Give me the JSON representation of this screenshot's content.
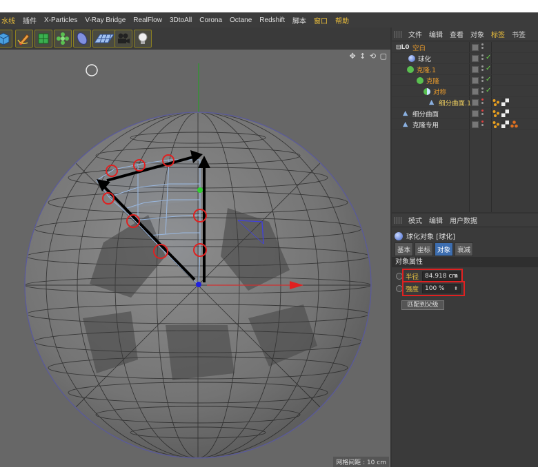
{
  "menubar": {
    "items": [
      {
        "label": "水线",
        "highlight": true
      },
      {
        "label": "插件",
        "highlight": false
      },
      {
        "label": "X-Particles",
        "highlight": false
      },
      {
        "label": "V-Ray Bridge",
        "highlight": false
      },
      {
        "label": "RealFlow",
        "highlight": false
      },
      {
        "label": "3DtoAll",
        "highlight": false
      },
      {
        "label": "Corona",
        "highlight": false
      },
      {
        "label": "Octane",
        "highlight": false
      },
      {
        "label": "Redshift",
        "highlight": false
      },
      {
        "label": "脚本",
        "highlight": false
      },
      {
        "label": "窗口",
        "highlight": false
      },
      {
        "label": "帮助",
        "highlight": true
      }
    ]
  },
  "toolbar": {
    "tools": [
      "cube-icon",
      "pen-icon",
      "subdivision-icon",
      "cloner-icon",
      "deformer-icon",
      "floor-icon",
      "camera-icon",
      "light-icon"
    ]
  },
  "viewport": {
    "grid_spacing_label": "网格间距 : 10 cm",
    "nav_icons": "✥ ↕ ⟲ ▢"
  },
  "object_manager": {
    "tabs": [
      {
        "label": "文件",
        "active": false
      },
      {
        "label": "编辑",
        "active": false
      },
      {
        "label": "查看",
        "active": false
      },
      {
        "label": "对象",
        "active": false
      },
      {
        "label": "标签",
        "active": true
      },
      {
        "label": "书签",
        "active": false
      }
    ],
    "rows": [
      {
        "name": "空白",
        "color": "orange",
        "indent": 0,
        "icon": "null-icon",
        "check": false,
        "tags": []
      },
      {
        "name": "球化",
        "color": "white",
        "indent": 1,
        "icon": "spherify-icon",
        "check": true,
        "tags": []
      },
      {
        "name": "克隆.1",
        "color": "orange",
        "indent": 1,
        "icon": "cloner-icon",
        "check": true,
        "tags": []
      },
      {
        "name": "克隆",
        "color": "orange",
        "indent": 2,
        "icon": "cloner-icon",
        "check": true,
        "tags": []
      },
      {
        "name": "对称",
        "color": "orange",
        "indent": 3,
        "icon": "symmetry-icon",
        "check": true,
        "tags": []
      },
      {
        "name": "细分曲面.1",
        "color": "yellow",
        "indent": 4,
        "icon": "subdivision-icon",
        "check": false,
        "tags": [
          "vertex-tag",
          "checker-tag"
        ]
      },
      {
        "name": "细分曲面",
        "color": "white",
        "indent": 0,
        "icon": "subdivision-icon",
        "check": false,
        "tags": [
          "vertex-tag",
          "checker-tag"
        ]
      },
      {
        "name": "克隆专用",
        "color": "white",
        "indent": 0,
        "icon": "subdivision-icon",
        "check": false,
        "tags": [
          "vertex-tag",
          "checker-tag",
          "material-tag"
        ]
      }
    ]
  },
  "attribute_manager": {
    "tabs": [
      {
        "label": "模式",
        "active": false
      },
      {
        "label": "编辑",
        "active": false
      },
      {
        "label": "用户数据",
        "active": false
      }
    ],
    "title": "球化对象 [球化]",
    "subtabs": [
      {
        "label": "基本",
        "active": false
      },
      {
        "label": "坐标",
        "active": false
      },
      {
        "label": "对象",
        "active": true
      },
      {
        "label": "衰减",
        "active": false
      }
    ],
    "section": "对象属性",
    "params": [
      {
        "label": "半径",
        "value": "84.918 cm"
      },
      {
        "label": "强度",
        "value": "100 %"
      }
    ],
    "match_button": "匹配到父级"
  },
  "colors": {
    "accent": "#f0c23b",
    "highlight_box": "#e02020",
    "active_tab": "#3d6eb0"
  }
}
